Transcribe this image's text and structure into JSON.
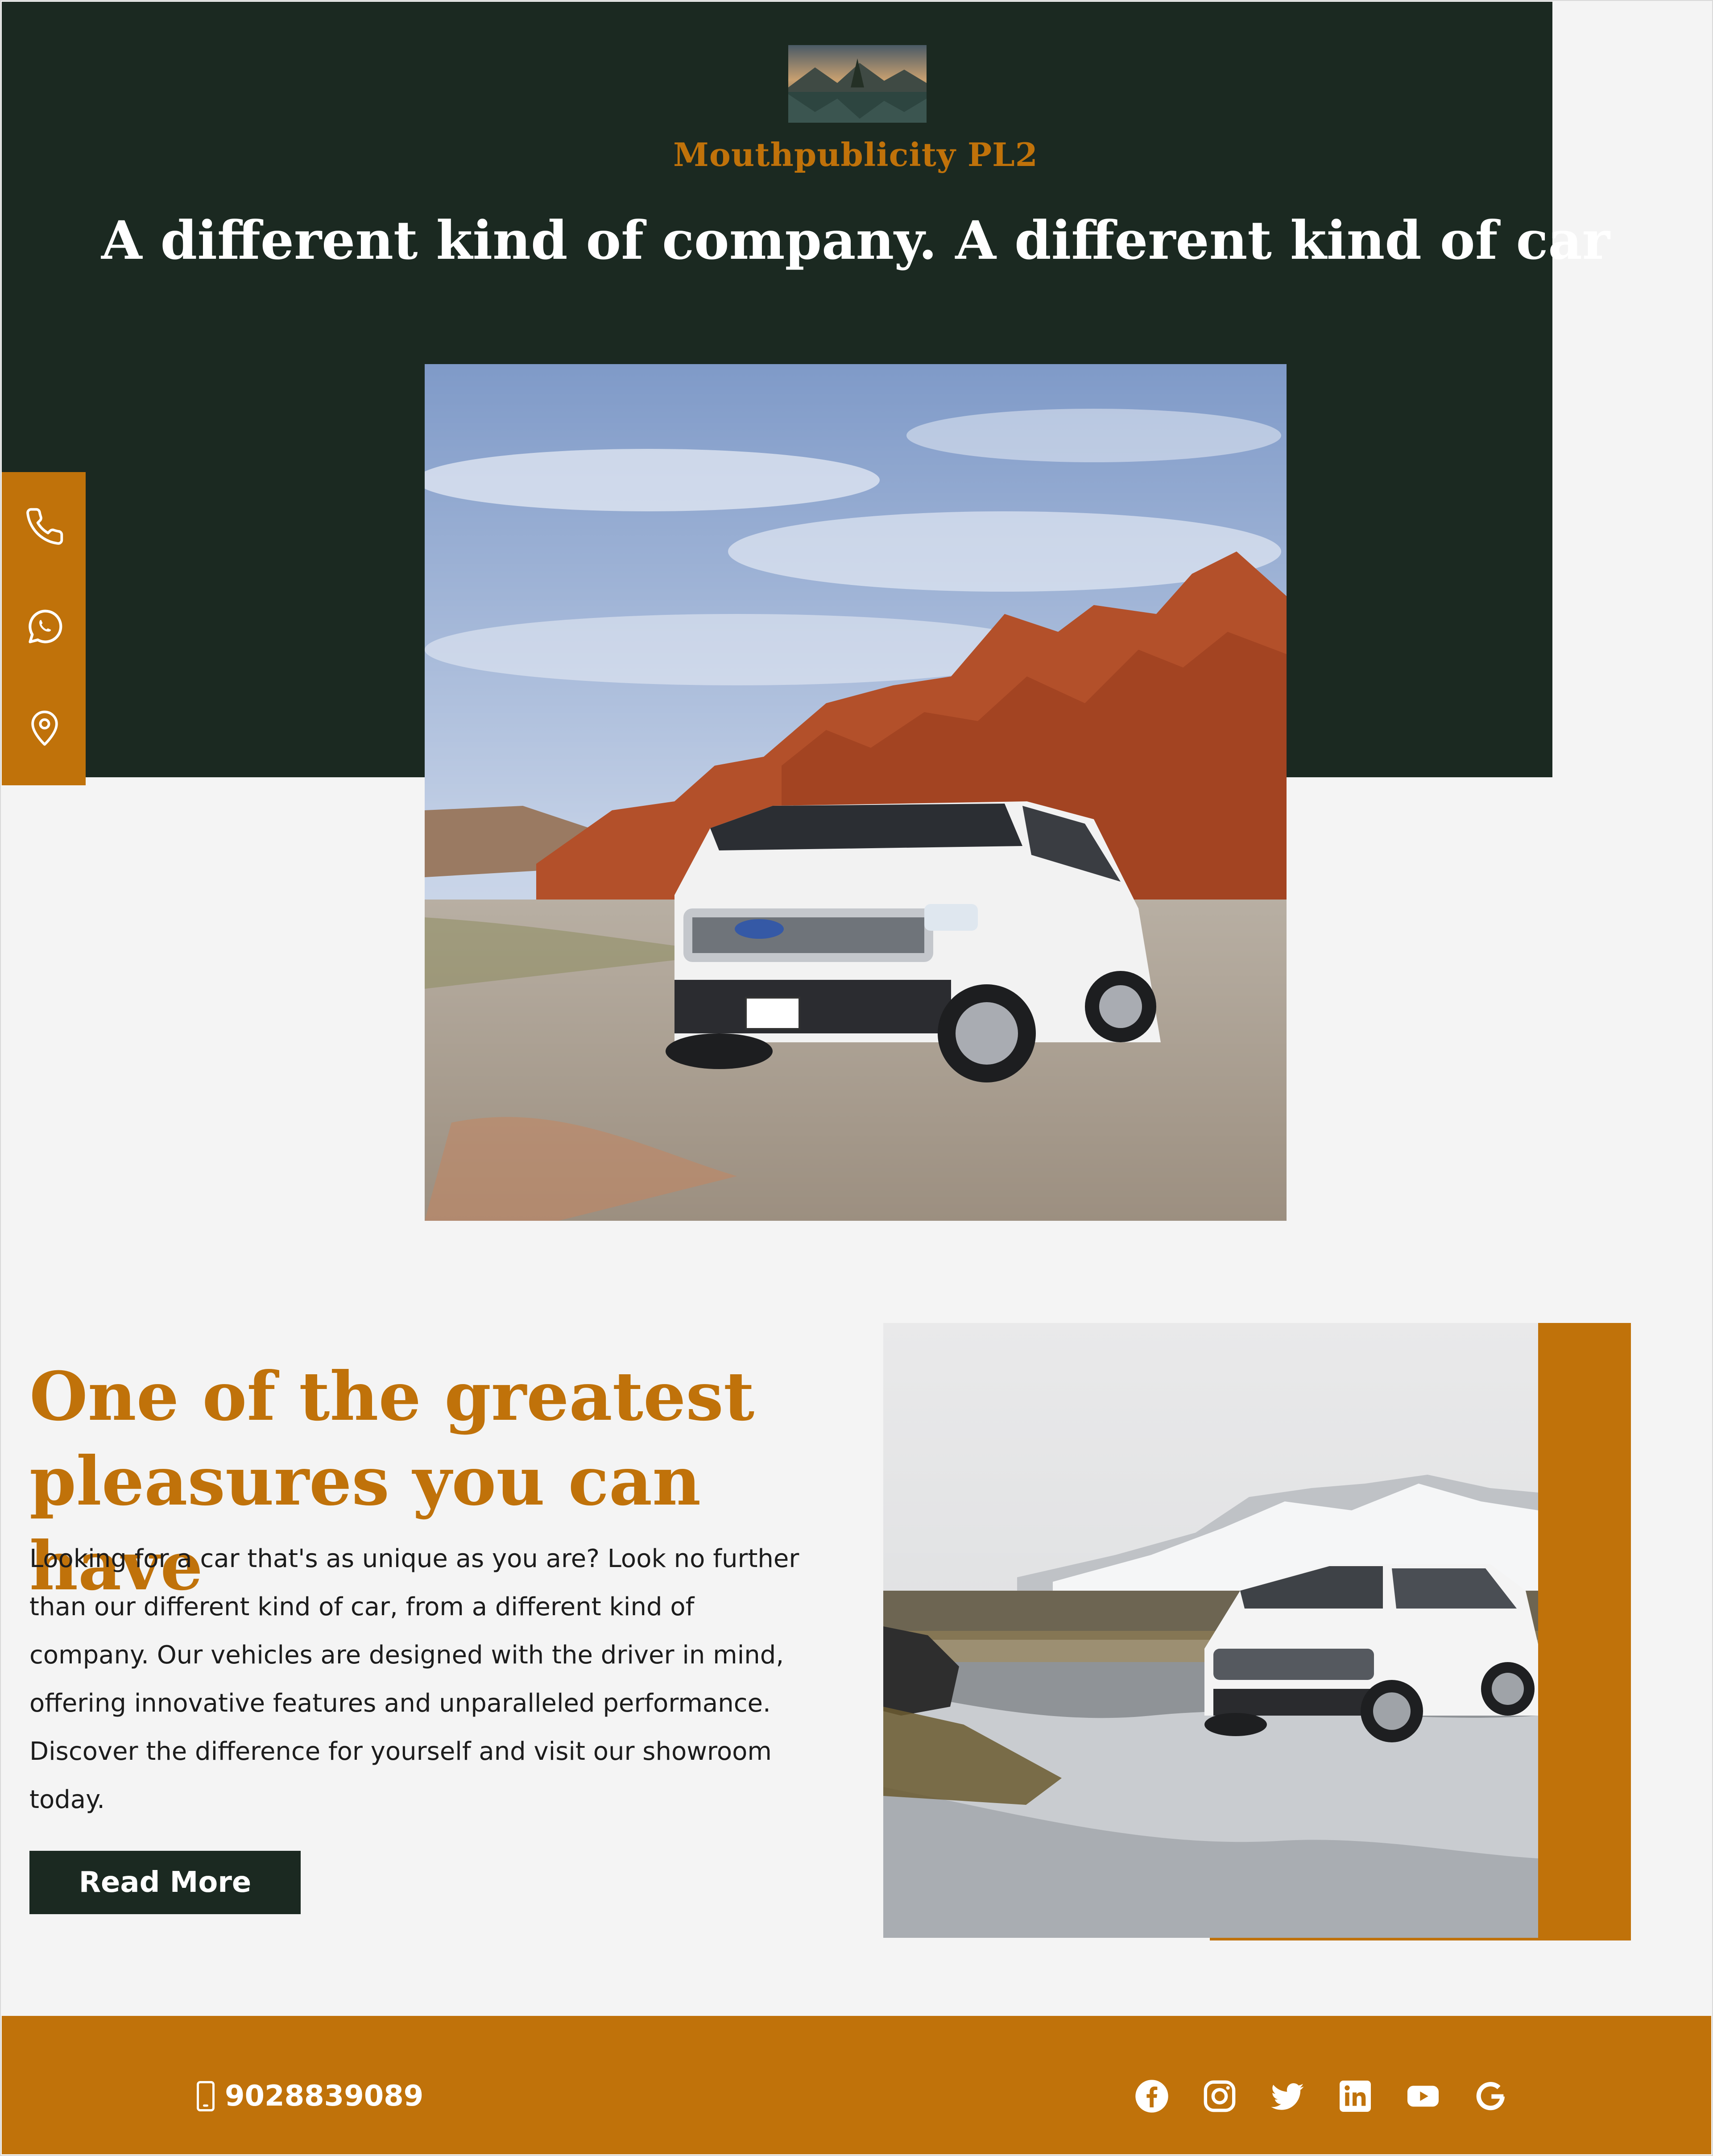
{
  "header": {
    "logo_icon": "landscape-logo",
    "brand": "Mouthpublicity PL2",
    "headline": "A different kind of company. A different kind of car"
  },
  "sidebar": {
    "items": [
      {
        "icon": "phone-icon"
      },
      {
        "icon": "whatsapp-icon"
      },
      {
        "icon": "location-pin-icon"
      }
    ]
  },
  "hero_image": {
    "subject": "white-suv-desert"
  },
  "feature": {
    "title_line1": "One of the greatest",
    "title_line2": "pleasures you can have",
    "body_lines": [
      "Looking for a car that's as unique as you are? Look no further",
      "than our different kind of car, from a different kind of",
      "company. Our vehicles are designed with the driver in mind,",
      "offering innovative features and unparalleled performance.",
      "Discover the difference for yourself and visit our showroom",
      "today."
    ],
    "button_label": "Read More",
    "image_subject": "white-crossover-snow"
  },
  "footer": {
    "phone": "9028839089",
    "social": [
      "facebook-icon",
      "instagram-icon",
      "twitter-icon",
      "linkedin-icon",
      "youtube-icon",
      "google-icon"
    ]
  },
  "colors": {
    "dark_green": "#1b2921",
    "accent_orange": "#c0720a",
    "background": "#f4f4f4",
    "white": "#ffffff"
  }
}
